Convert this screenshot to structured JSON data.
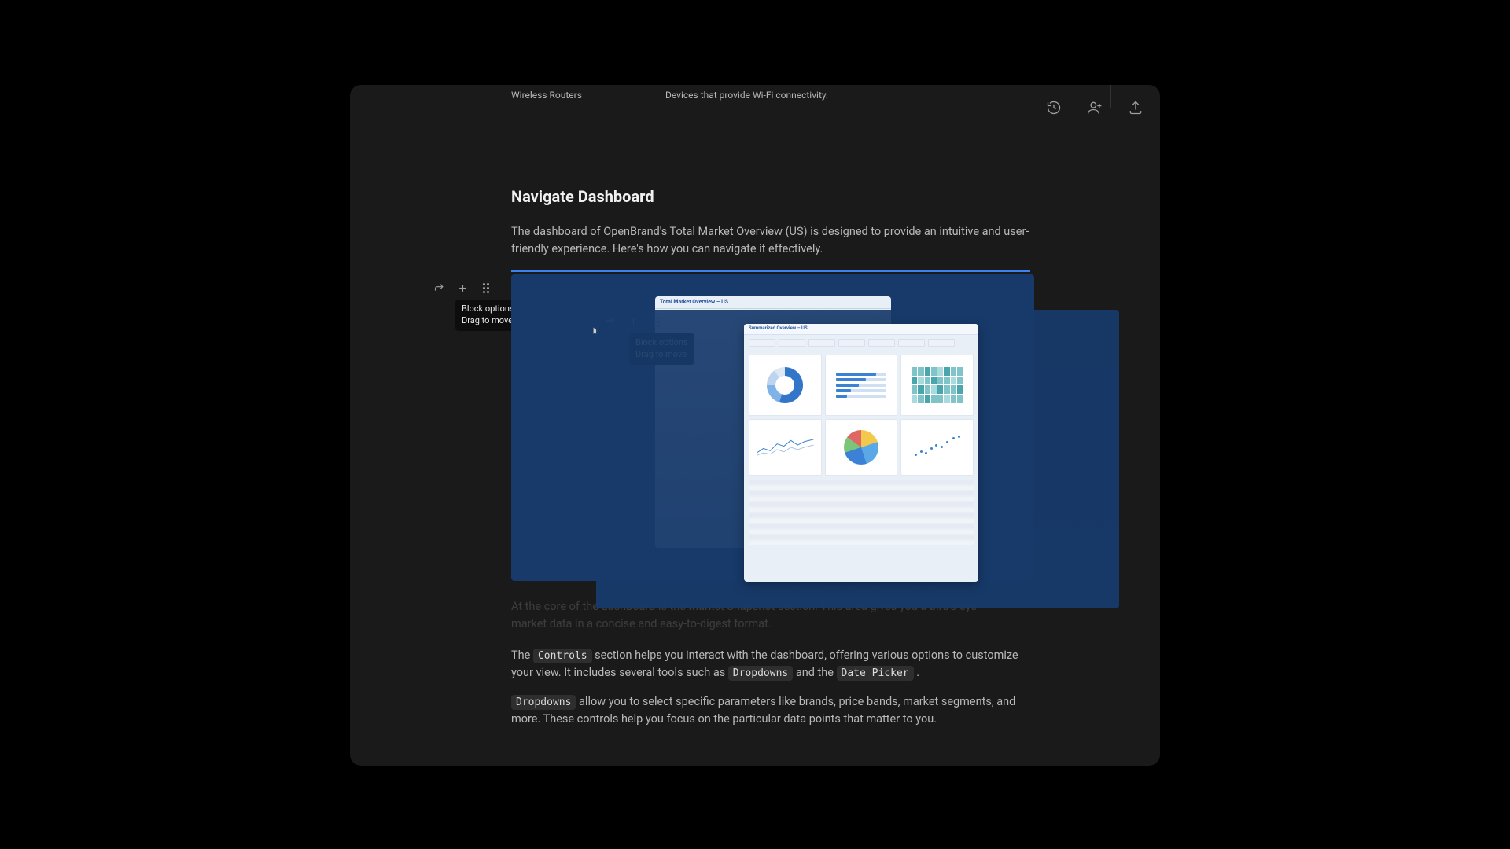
{
  "top_fragment": {
    "col1": "Wireless Routers",
    "col2": "Devices that provide Wi-Fi connectivity."
  },
  "section": {
    "title": "Navigate Dashboard",
    "intro": "The dashboard of OpenBrand's Total Market Overview (US) is designed to provide an intuitive and user-friendly experience. Here's how you can navigate it effectively."
  },
  "tooltip": {
    "line1": "Block options",
    "line2": "Drag to move"
  },
  "dash_header_small": "Total Market Overview – US",
  "dash_header_large": "Summarized Overview – US",
  "obscured_para": "At the core of the dashboard is the Market Snapshot section. This area gives you a bird's-eye market data in a concise and easy-to-digest format.",
  "p_controls_lead": "The ",
  "p_controls_code1": "Controls",
  "p_controls_mid": " section helps you interact with the dashboard, offering various options to customize your view. It includes several tools such as ",
  "p_controls_code2": "Dropdowns",
  "p_controls_mid2": " and the ",
  "p_controls_code3": "Date Picker",
  "p_controls_end": " .",
  "p_dropdowns_code": "Dropdowns",
  "p_dropdowns_rest": " allow you to select specific parameters like brands, price bands, market segments, and more. These controls help you focus on the particular data points that matter to you."
}
